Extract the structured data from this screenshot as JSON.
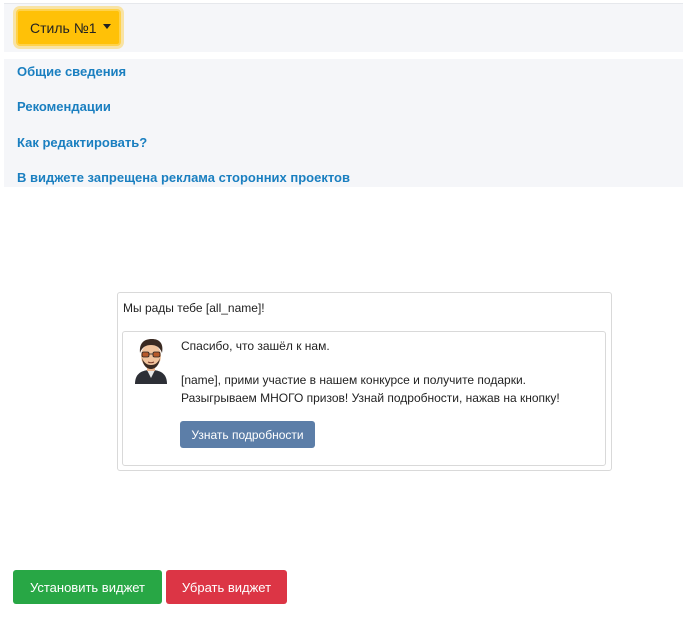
{
  "style_dropdown": {
    "label": "Стиль №1",
    "accent_color": "#ffc107"
  },
  "info_links": [
    "Общие сведения",
    "Рекомендации",
    "Как редактировать?",
    "В виджете запрещена реклама сторонних проектов"
  ],
  "widget": {
    "greeting": "Мы рады тебе [all_name]!",
    "avatar_icon": "cartoon-man-with-glasses",
    "message_lines": [
      "Спасибо, что зашёл к нам.",
      "[name], прими участие в нашем конкурсе и получите подарки.",
      "Разыгрываем МНОГО призов! Узнай подробности, нажав на кнопку!"
    ],
    "button_label": "Узнать подробности",
    "button_color": "#5c7ea8"
  },
  "actions": {
    "install_label": "Установить виджет",
    "install_color": "#28a745",
    "remove_label": "Убрать виджет",
    "remove_color": "#dc3545"
  }
}
